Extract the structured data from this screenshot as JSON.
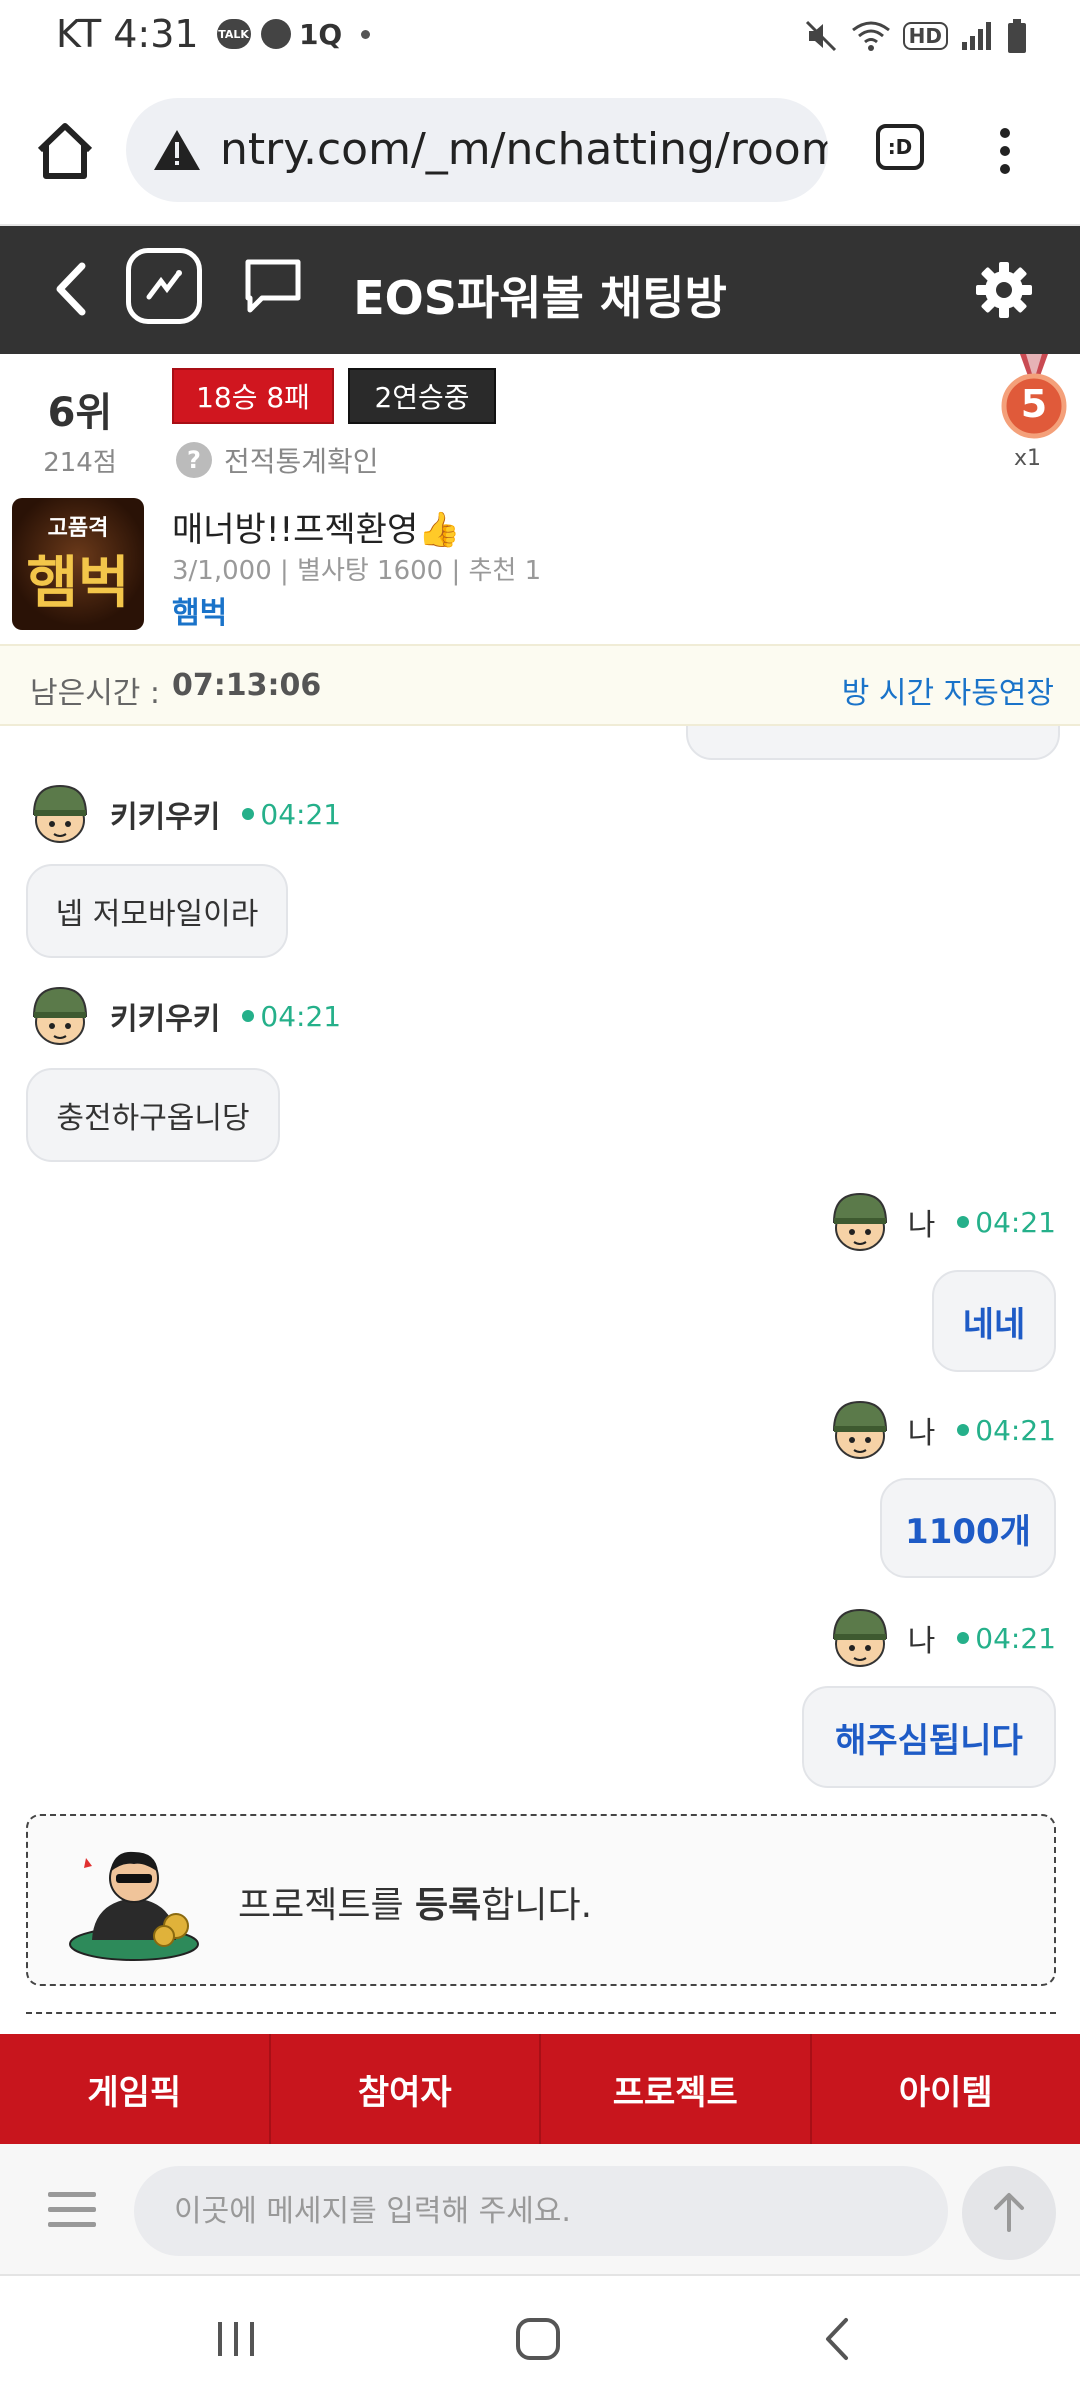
{
  "status_bar": {
    "carrier_time": "KT 4:31",
    "icons": [
      "talk-icon",
      "chat-bubble-icon",
      "one-q-icon",
      "dot-icon",
      "mute-icon",
      "wifi-icon",
      "hd-icon",
      "signal-icon",
      "battery-icon"
    ],
    "talk_label": "TALK",
    "oneq_label": "1Q",
    "hd_label": "HD"
  },
  "browser": {
    "url": "ntry.com/_m/nchatting/room",
    "tab_switcher_label": ":D"
  },
  "header": {
    "title": "EOS파워볼 채팅방"
  },
  "room": {
    "rank": "6위",
    "points": "214점",
    "record": "18승 8패",
    "streak": "2연승중",
    "stats_link": "전적통계확인",
    "medal_number": "5",
    "medal_count": "x1",
    "thumb_top": "고품격",
    "thumb_main": "햄벅",
    "name": "매너방!!프젝환영👍",
    "meta": "3/1,000 | 별사탕 1600 | 추천 1",
    "owner": "햄벅"
  },
  "timer": {
    "label": "남은시간 :",
    "value": "07:13:06",
    "extend": "방 시간 자동연장"
  },
  "messages": [
    {
      "nick": "키키우키",
      "time": "04:21",
      "text": "넵 저모바일이라",
      "mine": false
    },
    {
      "nick": "키키우키",
      "time": "04:21",
      "text": "충전하구옵니당",
      "mine": false
    },
    {
      "nick": "나",
      "time": "04:21",
      "text": "네네",
      "mine": true
    },
    {
      "nick": "나",
      "time": "04:21",
      "text": "1100개",
      "mine": true
    },
    {
      "nick": "나",
      "time": "04:21",
      "text": "해주심됩니다",
      "mine": true
    }
  ],
  "notice": {
    "prefix": "프로젝트를 ",
    "bold": "등록",
    "suffix": "합니다."
  },
  "tabs": [
    "게임픽",
    "참여자",
    "프로젝트",
    "아이템"
  ],
  "input": {
    "placeholder": "이곳에 메세지를 입력해 주세요."
  },
  "colors": {
    "header_bg": "#333333",
    "tab_red": "#c8151d",
    "online_green": "#25b08a",
    "link_blue": "#1a73c9"
  }
}
